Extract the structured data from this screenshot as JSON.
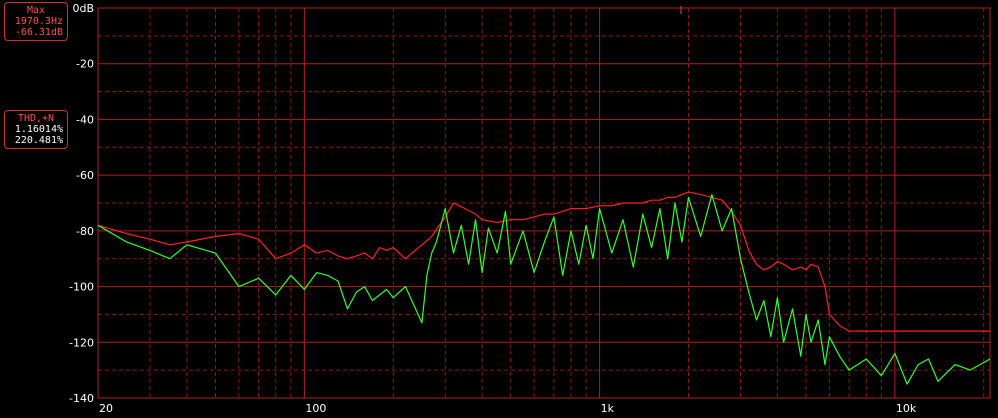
{
  "readouts": {
    "max": {
      "title": "Max",
      "freq": "1970.3Hz",
      "level": "-66.31dB"
    },
    "thd": {
      "title": "THD,+N",
      "percent1": "1.16014%",
      "percent2": "220.481%"
    }
  },
  "colors": {
    "background": "#000000",
    "grid": "#8a1a1a",
    "grid_major": "#b02020",
    "series_red": "#ff2020",
    "series_green": "#30ff30"
  },
  "chart_data": {
    "type": "line",
    "xscale": "log",
    "xlim": [
      20,
      21000
    ],
    "ylim": [
      -140,
      0
    ],
    "grid": true,
    "x_ticks": [
      {
        "value": 20,
        "label": "20"
      },
      {
        "value": 100,
        "label": "100"
      },
      {
        "value": 1000,
        "label": "1k"
      },
      {
        "value": 10000,
        "label": "10k"
      }
    ],
    "y_ticks": [
      {
        "value": 0,
        "label": "0dB"
      },
      {
        "value": -20,
        "label": "-20"
      },
      {
        "value": -40,
        "label": "-40"
      },
      {
        "value": -60,
        "label": "-60"
      },
      {
        "value": -80,
        "label": "-80"
      },
      {
        "value": -100,
        "label": "-100"
      },
      {
        "value": -120,
        "label": "-120"
      },
      {
        "value": -140,
        "label": "-140"
      }
    ],
    "series": [
      {
        "color": "#ff2020",
        "x": [
          20,
          25,
          30,
          35,
          40,
          50,
          60,
          70,
          80,
          90,
          100,
          110,
          120,
          130,
          140,
          150,
          160,
          170,
          180,
          190,
          200,
          220,
          250,
          270,
          300,
          320,
          350,
          380,
          400,
          450,
          500,
          550,
          600,
          650,
          700,
          750,
          800,
          900,
          1000,
          1100,
          1200,
          1300,
          1400,
          1500,
          1600,
          1700,
          1800,
          1900,
          2000,
          2200,
          2400,
          2600,
          2800,
          3000,
          3200,
          3400,
          3600,
          3800,
          4000,
          4200,
          4500,
          4800,
          5000,
          5200,
          5500,
          5800,
          6000,
          6500,
          7000,
          8000,
          9000,
          10000,
          12000,
          14000,
          16000,
          18000,
          21000
        ],
        "y": [
          -78,
          -81,
          -83,
          -85,
          -84,
          -82,
          -81,
          -83,
          -90,
          -88,
          -85,
          -88,
          -87,
          -89,
          -90,
          -89,
          -88,
          -90,
          -86,
          -87,
          -86,
          -90,
          -85,
          -82,
          -75,
          -70,
          -72,
          -74,
          -76,
          -77,
          -76,
          -76,
          -75,
          -74,
          -74,
          -73,
          -72,
          -72,
          -71,
          -71,
          -70,
          -70,
          -70,
          -69,
          -69,
          -68,
          -68,
          -67,
          -66,
          -67,
          -68,
          -69,
          -73,
          -78,
          -87,
          -92,
          -94,
          -93,
          -91,
          -92,
          -94,
          -93,
          -94,
          -92,
          -93,
          -100,
          -110,
          -114,
          -116,
          -116,
          -116,
          -116,
          -116,
          -116,
          -116,
          -116,
          -116
        ]
      },
      {
        "color": "#30ff30",
        "x": [
          20,
          25,
          30,
          35,
          40,
          50,
          60,
          70,
          80,
          90,
          100,
          110,
          120,
          130,
          140,
          150,
          160,
          170,
          180,
          190,
          200,
          220,
          250,
          260,
          270,
          280,
          300,
          320,
          340,
          360,
          380,
          400,
          420,
          450,
          480,
          500,
          550,
          600,
          650,
          700,
          750,
          800,
          850,
          900,
          950,
          1000,
          1100,
          1200,
          1300,
          1400,
          1500,
          1600,
          1700,
          1800,
          1900,
          2000,
          2200,
          2400,
          2600,
          2800,
          3000,
          3200,
          3400,
          3600,
          3800,
          4000,
          4200,
          4500,
          4800,
          5000,
          5200,
          5500,
          5800,
          6000,
          6500,
          7000,
          8000,
          9000,
          10000,
          11000,
          12000,
          13000,
          14000,
          16000,
          18000,
          21000
        ],
        "y": [
          -78,
          -84,
          -87,
          -90,
          -85,
          -88,
          -100,
          -97,
          -103,
          -96,
          -101,
          -95,
          -96,
          -98,
          -108,
          -102,
          -100,
          -105,
          -103,
          -101,
          -104,
          -100,
          -113,
          -96,
          -88,
          -84,
          -72,
          -88,
          -78,
          -92,
          -76,
          -95,
          -79,
          -88,
          -73,
          -92,
          -80,
          -95,
          -84,
          -75,
          -96,
          -80,
          -92,
          -78,
          -90,
          -72,
          -88,
          -76,
          -93,
          -74,
          -86,
          -72,
          -90,
          -70,
          -84,
          -68,
          -82,
          -67,
          -80,
          -72,
          -90,
          -102,
          -112,
          -105,
          -118,
          -104,
          -120,
          -108,
          -125,
          -110,
          -120,
          -112,
          -128,
          -118,
          -125,
          -130,
          -126,
          -132,
          -124,
          -135,
          -128,
          -126,
          -134,
          -128,
          -130,
          -126
        ]
      }
    ]
  }
}
